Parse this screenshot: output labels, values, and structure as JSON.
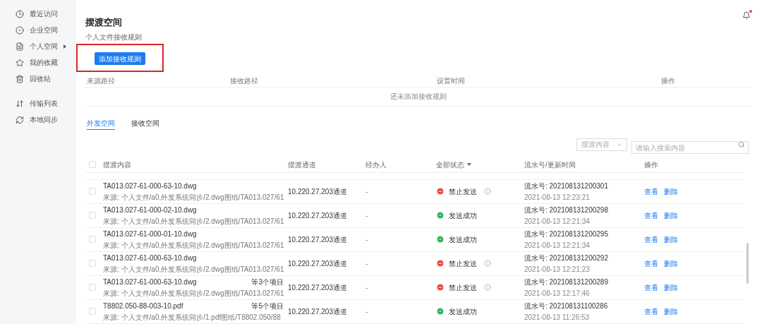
{
  "sidebar": {
    "items": [
      {
        "label": "最近访问",
        "kind": "link"
      },
      {
        "label": "企业空间",
        "kind": "link"
      },
      {
        "label": "个人空间",
        "kind": "submenu"
      },
      {
        "label": "我的收藏",
        "kind": "link"
      },
      {
        "label": "回收站",
        "kind": "link"
      },
      {
        "label": "传输列表",
        "kind": "link"
      },
      {
        "label": "本地同步",
        "kind": "link"
      }
    ]
  },
  "header": {
    "title": "摆渡空间",
    "subtitle": "个人文件接收规则",
    "add_button": {
      "label": "添加接收规则",
      "highlighted": true
    },
    "notifications": {
      "unread": true
    }
  },
  "rules_table": {
    "columns": [
      "来源路径",
      "接收路径",
      "设置时间",
      "操作"
    ],
    "empty_text": "还未添加接收规则"
  },
  "tabs": [
    {
      "label": "外发空间",
      "selected": true
    },
    {
      "label": "接收空间",
      "selected": false
    }
  ],
  "filter": {
    "select_placeholder": "摆渡内容",
    "search_placeholder": "请输入搜索内容"
  },
  "table": {
    "all_checked": false,
    "columns": [
      {
        "label": "摆渡内容",
        "kind": "plain"
      },
      {
        "label": "摆渡通道",
        "kind": "plain"
      },
      {
        "label": "经办人",
        "kind": "plain"
      },
      {
        "label": "全部状态",
        "kind": "filter"
      },
      {
        "label": "流水号/更新时间",
        "kind": "plain"
      },
      {
        "label": "操作",
        "kind": "plain"
      }
    ],
    "rows": [
      {
        "checked": false,
        "name": "TA013.027-61-000-63-10.dwg",
        "extra": "",
        "source": "来源: 个人文件/a0.外发系统同步/2.dwg图纸/TA013.027/61",
        "channel": "10.220.27.203通道",
        "handler": "-",
        "status": {
          "kind": "blocked",
          "label": "禁止发送"
        },
        "serial": "流水号: 202108131200301",
        "time": "2021-08-13 12:23:21",
        "actions": [
          "查看",
          "删除"
        ]
      },
      {
        "checked": false,
        "name": "TA013.027-61-000-02-10.dwg",
        "extra": "",
        "source": "来源: 个人文件/a0.外发系统同步/2.dwg图纸/TA013.027/61",
        "channel": "10.220.27.203通道",
        "handler": "-",
        "status": {
          "kind": "success",
          "label": "发送成功"
        },
        "serial": "流水号: 202108131200298",
        "time": "2021-08-13 12:21:34",
        "actions": [
          "查看",
          "删除"
        ]
      },
      {
        "checked": false,
        "name": "TA013.027-61-000-01-10.dwg",
        "extra": "",
        "source": "来源: 个人文件/a0.外发系统同步/2.dwg图纸/TA013.027/61",
        "channel": "10.220.27.203通道",
        "handler": "-",
        "status": {
          "kind": "success",
          "label": "发送成功"
        },
        "serial": "流水号: 202108131200295",
        "time": "2021-08-13 12:21:34",
        "actions": [
          "查看",
          "删除"
        ]
      },
      {
        "checked": false,
        "name": "TA013.027-61-000-63-10.dwg",
        "extra": "",
        "source": "来源: 个人文件/a0.外发系统同步/2.dwg图纸/TA013.027/61",
        "channel": "10.220.27.203通道",
        "handler": "-",
        "status": {
          "kind": "blocked",
          "label": "禁止发送"
        },
        "serial": "流水号: 202108131200292",
        "time": "2021-08-13 12:21:23",
        "actions": [
          "查看",
          "删除"
        ]
      },
      {
        "checked": false,
        "name": "TA013.027-61-000-63-10.dwg",
        "extra": "等3个项目",
        "source": "来源: 个人文件/a0.外发系统同步/2.dwg图纸/TA013.027/61",
        "channel": "10.220.27.203通道",
        "handler": "-",
        "status": {
          "kind": "blocked",
          "label": "禁止发送"
        },
        "serial": "流水号: 202108131200289",
        "time": "2021-08-13 12:17:46",
        "actions": [
          "查看",
          "删除"
        ]
      },
      {
        "checked": false,
        "name": "T8802.050-88-003-10.pdf",
        "extra": "等5个项目",
        "source": "来源: 个人文件/a0.外发系统同步/1.pdf图纸/T8802.050/88",
        "channel": "10.220.27.203通道",
        "handler": "-",
        "status": {
          "kind": "success",
          "label": "发送成功"
        },
        "serial": "流水号: 202108131100286",
        "time": "2021-08-13 11:26:53",
        "actions": [
          "查看",
          "删除"
        ]
      }
    ]
  }
}
